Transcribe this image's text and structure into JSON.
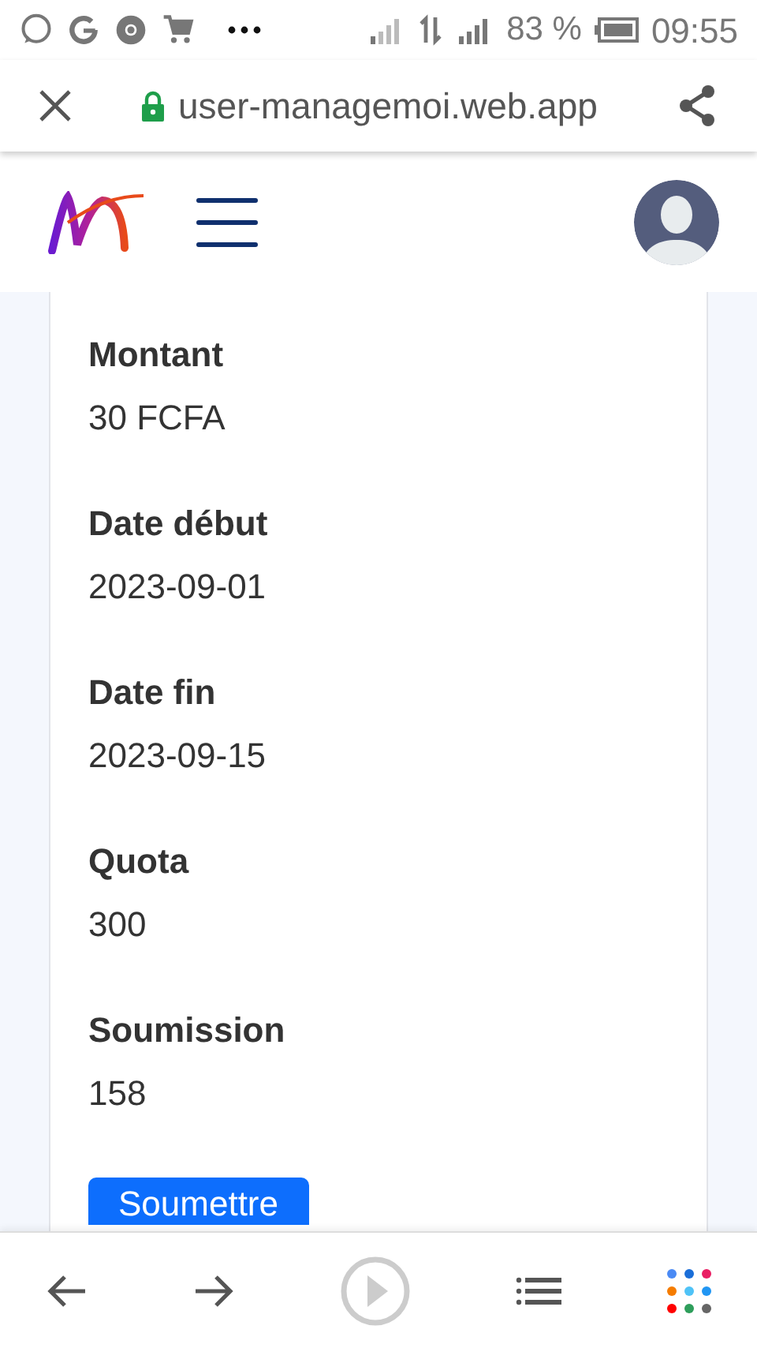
{
  "status_bar": {
    "battery": "83 %",
    "time": "09:55"
  },
  "url_bar": {
    "url": "user-managemoi.web.app"
  },
  "fields": [
    {
      "label": "Montant",
      "value": "30 FCFA"
    },
    {
      "label": "Date début",
      "value": "2023-09-01"
    },
    {
      "label": "Date fin",
      "value": "2023-09-15"
    },
    {
      "label": "Quota",
      "value": "300"
    },
    {
      "label": "Soumission",
      "value": "158"
    }
  ],
  "submit_button": {
    "label": "Soumettre"
  }
}
